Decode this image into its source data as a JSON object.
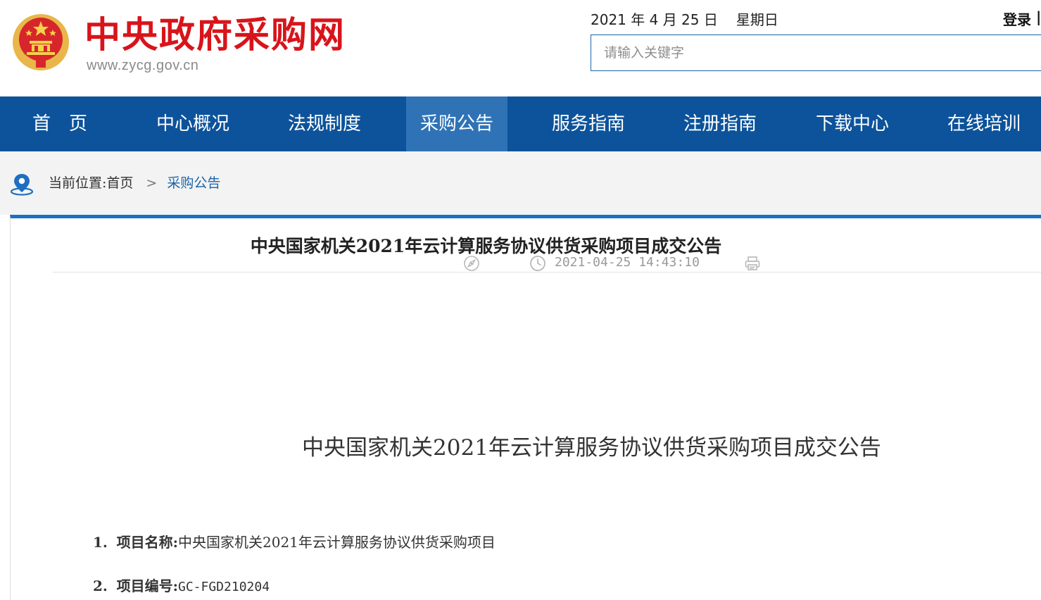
{
  "header": {
    "site_title": "中央政府采购网",
    "site_url": "www.zycg.gov.cn",
    "date": "2021 年 4 月 25 日",
    "weekday": "星期日",
    "login_label": "登录",
    "separator": "|",
    "search_placeholder": "请输入关键字",
    "emblem_icon": "national-emblem-icon"
  },
  "nav": {
    "items": [
      {
        "label": "首　页"
      },
      {
        "label": "中心概况"
      },
      {
        "label": "法规制度"
      },
      {
        "label": "采购公告",
        "active": true
      },
      {
        "label": "服务指南"
      },
      {
        "label": "注册指南"
      },
      {
        "label": "下载中心"
      },
      {
        "label": "在线培训"
      }
    ],
    "bar_color": "#0d539b",
    "active_color": "#2f73b6"
  },
  "breadcrumb": {
    "prefix": "当前位置:",
    "home": "首页",
    "arrow": ">",
    "current": "采购公告",
    "icon": "location-pin-icon"
  },
  "article": {
    "title": "中央国家机关2021年云计算服务协议供货采购项目成交公告",
    "published": "2021-04-25 14:43:10",
    "meta_icons": [
      "compass-icon",
      "clock-icon",
      "print-icon"
    ],
    "body_title": "中央国家机关2021年云计算服务协议供货采购项目成交公告",
    "items": [
      {
        "index": "1.",
        "label": "项目名称:",
        "value": "中央国家机关2021年云计算服务协议供货采购项目"
      },
      {
        "index": "2.",
        "label": "项目编号:",
        "value": "GC-FGD210204"
      }
    ],
    "accent_color": "#1771c9"
  }
}
